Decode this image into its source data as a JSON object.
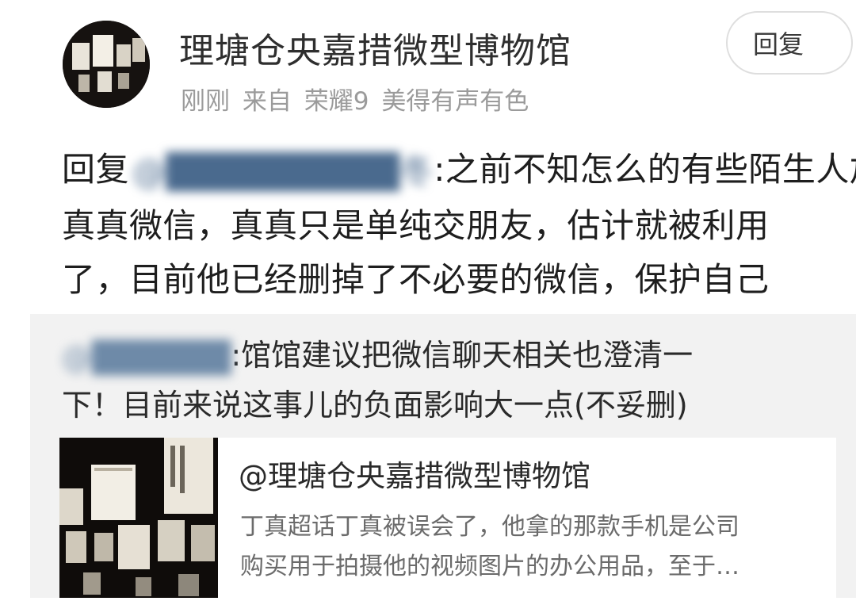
{
  "post": {
    "author": "理塘仓央嘉措微型博物馆",
    "time": "刚刚",
    "source_prefix": "来自",
    "device": "荣耀9",
    "device_slogan": "美得有声有色",
    "reply_button": "回复",
    "comment": {
      "prefix": "回复",
      "mention": "@█████████冬",
      "lines": [
        ":之前不知怎么的有些陌生人加",
        "真真微信，真真只是单纯交朋友，估计就被利用",
        "了，目前他已经删掉了不必要的微信，保护自己"
      ]
    }
  },
  "quoted": {
    "mention": "@██████",
    "lines": [
      ":馆馆建议把微信聊天相关也澄清一",
      "下！目前来说这事儿的负面影响大一点(不妥删)"
    ]
  },
  "card": {
    "title": "@理塘仓央嘉措微型博物馆",
    "desc_lines": [
      "丁真超话丁真被误会了，他拿的那款手机是公司",
      "购买用于拍摄他的视频图片的办公用品，至于…"
    ]
  }
}
